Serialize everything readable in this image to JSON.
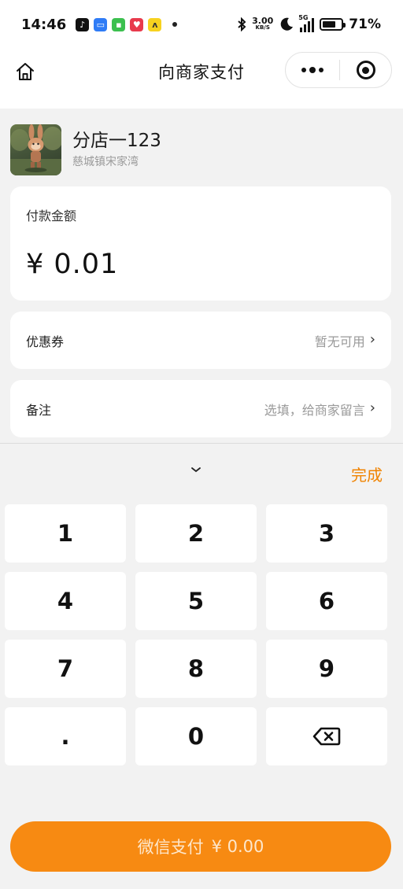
{
  "status_bar": {
    "time": "14:46",
    "net_speed_value": "3.00",
    "net_speed_unit": "KB/S",
    "network": "5G",
    "battery_percent": "71%",
    "battery_level": 0.71
  },
  "nav": {
    "title": "向商家支付",
    "home_icon": "home-icon",
    "more_icon": "more-dots-icon",
    "close_icon": "target-close-icon"
  },
  "merchant": {
    "name": "分店一123",
    "address": "慈城镇宋家湾"
  },
  "amount": {
    "label": "付款金额",
    "value": "¥ 0.01"
  },
  "coupon": {
    "label": "优惠券",
    "value": "暂无可用"
  },
  "note": {
    "label": "备注",
    "placeholder": "选填，给商家留言"
  },
  "keyboard": {
    "done_label": "完成",
    "keys": [
      "1",
      "2",
      "3",
      "4",
      "5",
      "6",
      "7",
      "8",
      "9",
      ".",
      "0"
    ],
    "delete_icon": "backspace-icon"
  },
  "pay_button": {
    "label": "微信支付",
    "amount": "¥ 0.00"
  },
  "colors": {
    "accent": "#f78a12",
    "done_text": "#f08300",
    "background": "#f2f2f2"
  }
}
